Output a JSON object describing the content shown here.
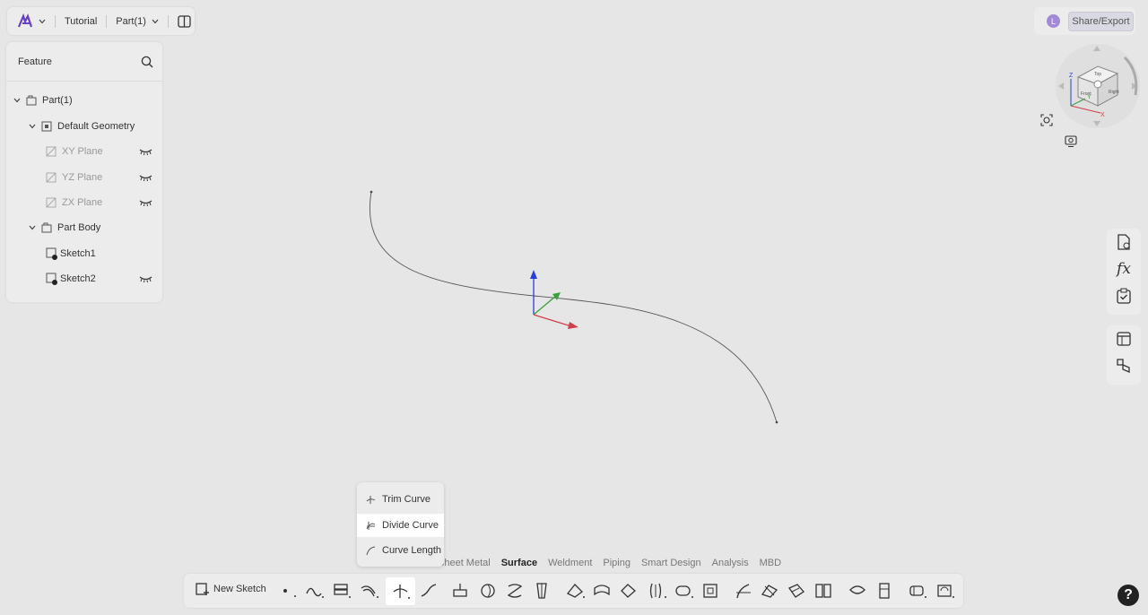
{
  "topbar": {
    "project": "Tutorial",
    "part": "Part(1)"
  },
  "share": {
    "avatar_initial": "L",
    "button_label": "Share/Export"
  },
  "feature_panel": {
    "title": "Feature",
    "tree": [
      {
        "label": "Part(1)",
        "dim": false
      },
      {
        "label": "Default Geometry",
        "dim": false
      },
      {
        "label": "XY Plane",
        "dim": true
      },
      {
        "label": "YZ Plane",
        "dim": true
      },
      {
        "label": "ZX Plane",
        "dim": true
      },
      {
        "label": "Part Body",
        "dim": false
      },
      {
        "label": "Sketch1",
        "dim": false
      },
      {
        "label": "Sketch2",
        "dim": false
      }
    ]
  },
  "viewcube": {
    "faces": [
      "Top",
      "Front",
      "Right"
    ],
    "axes": [
      "Z",
      "Y",
      "X"
    ]
  },
  "tabs": {
    "items": [
      "Sheet Metal",
      "Surface",
      "Weldment",
      "Piping",
      "Smart Design",
      "Analysis",
      "MBD"
    ],
    "active": "Surface"
  },
  "toolbar": {
    "new_sketch": "New Sketch"
  },
  "popup_menu": {
    "items": [
      "Trim Curve",
      "Divide Curve",
      "Curve Length"
    ],
    "selected": "Divide Curve"
  },
  "help": {
    "label": "?"
  },
  "colors": {
    "axis_x": "#d0404a",
    "axis_y": "#3aa03a",
    "axis_z": "#2a3ed8",
    "logo": "#6a3fc8"
  }
}
